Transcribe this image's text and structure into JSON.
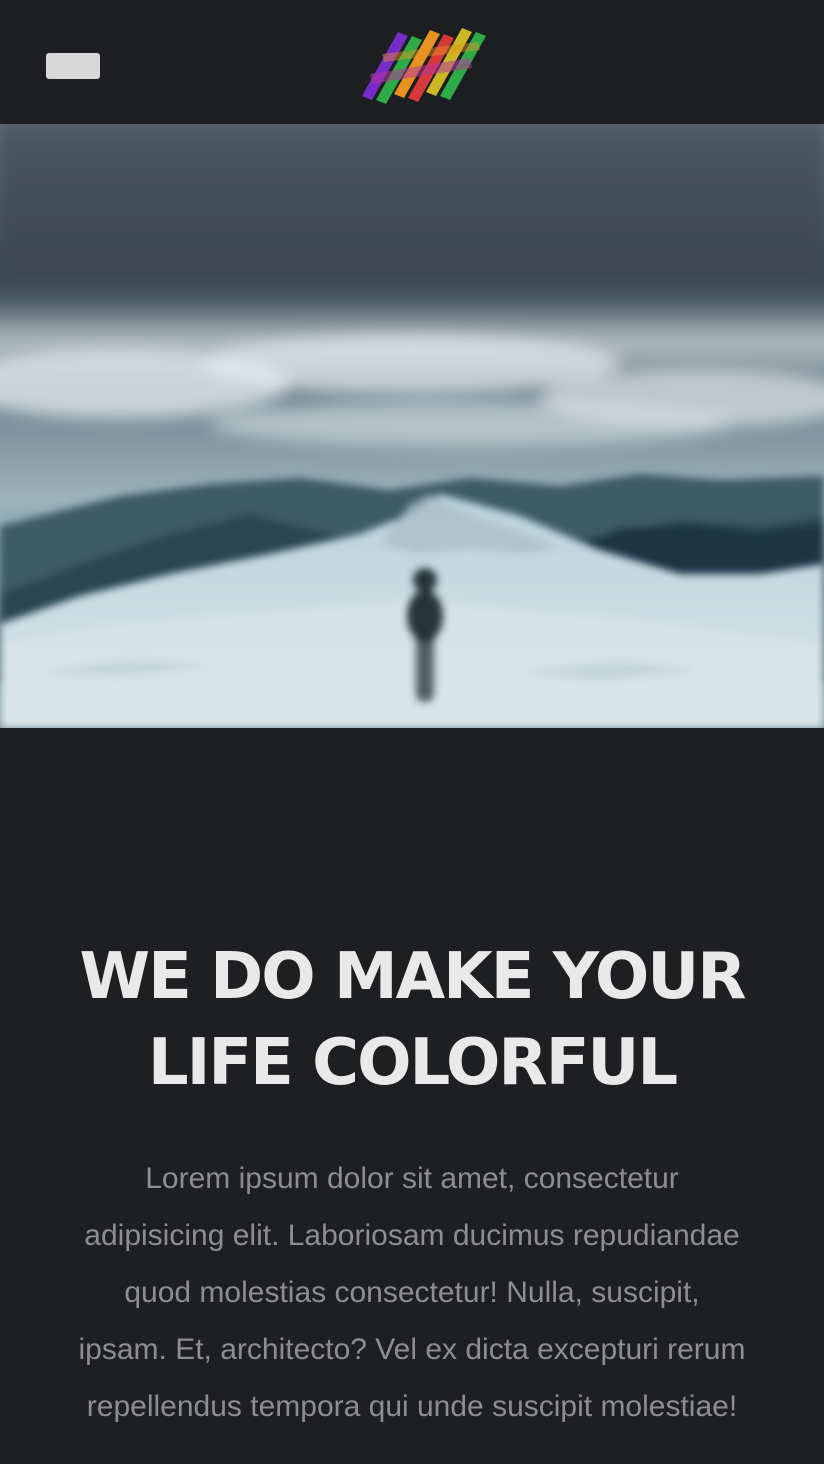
{
  "header": {
    "menu_icon": "hamburger-menu-icon",
    "logo_icon": "colorful-brand-logo-icon",
    "logo_colors": [
      "#7b2bd0",
      "#2fb34a",
      "#f29a22",
      "#e23b3b",
      "#d6c128",
      "#c03aa3"
    ]
  },
  "hero": {
    "image": "snowy-mountain-hiker-photo"
  },
  "main": {
    "headline": "WE DO MAKE YOUR LIFE COLORFUL",
    "body": "Lorem ipsum dolor sit amet, consectetur adipisicing elit. Laboriosam ducimus repudiandae quod molestias consectetur! Nulla, suscipit, ipsam. Et, architecto? Vel ex dicta excepturi rerum repellendus tempora qui unde suscipit molestiae!"
  }
}
